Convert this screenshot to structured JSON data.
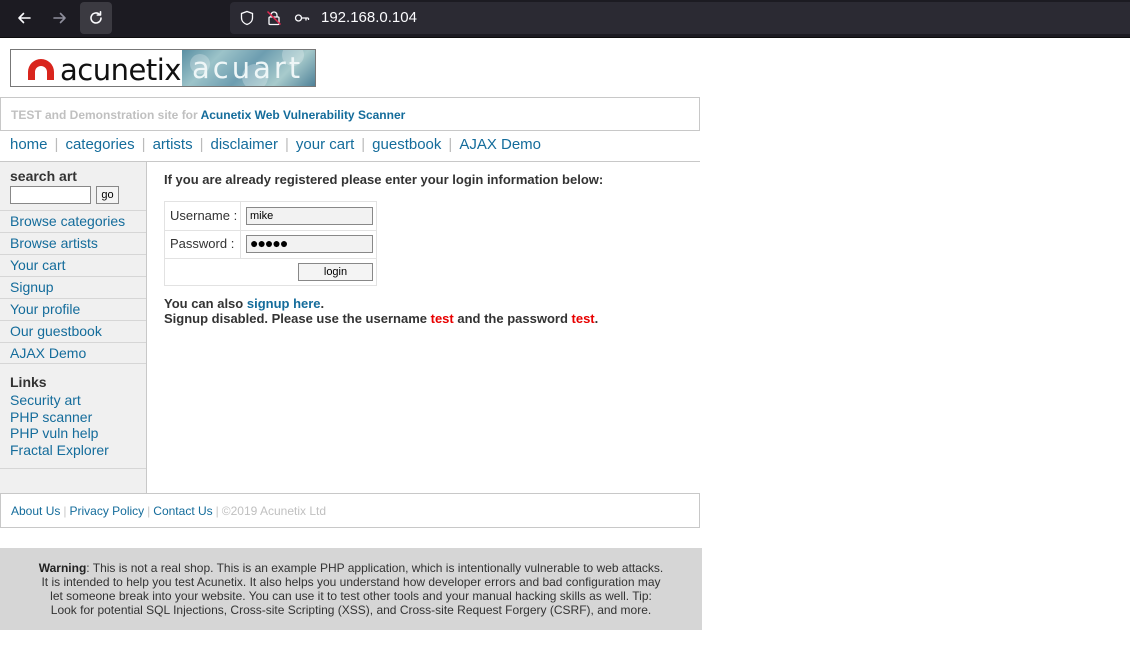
{
  "browser": {
    "url": "192.168.0.104"
  },
  "header": {
    "logo_brand": "acunetix",
    "logo_product": "acuart",
    "tagline_prefix": "TEST and Demonstration site for",
    "tagline_link": "Acunetix Web Vulnerability Scanner"
  },
  "topnav": {
    "items": [
      "home",
      "categories",
      "artists",
      "disclaimer",
      "your cart",
      "guestbook",
      "AJAX Demo"
    ]
  },
  "sidebar": {
    "search_title": "search art",
    "search_value": "",
    "go_label": "go",
    "nav_items": [
      "Browse categories",
      "Browse artists",
      "Your cart",
      "Signup",
      "Your profile",
      "Our guestbook",
      "AJAX Demo"
    ],
    "links_title": "Links",
    "links": [
      "Security art",
      "PHP scanner",
      "PHP vuln help",
      "Fractal Explorer"
    ]
  },
  "login": {
    "intro": "If you are already registered please enter your login information below:",
    "username_label": "Username :",
    "username_value": "mike",
    "password_label": "Password :",
    "password_value": "●●●●●",
    "button_label": "login",
    "signup_prefix": "You can also",
    "signup_link": "signup here",
    "signup_suffix": ".",
    "disabled_1": "Signup disabled. Please use the username",
    "disabled_user": "test",
    "disabled_2": "and the password",
    "disabled_pass": "test",
    "disabled_end": "."
  },
  "footer": {
    "about": "About Us",
    "privacy": "Privacy Policy",
    "contact": "Contact Us",
    "copyright": "©2019 Acunetix Ltd"
  },
  "warning": {
    "title": "Warning",
    "line1": ": This is not a real shop. This is an example PHP application, which is intentionally vulnerable to web attacks.",
    "line2": "It is intended to help you test Acunetix. It also helps you understand how developer errors and bad configuration may",
    "line3": "let someone break into your website. You can use it to test other tools and your manual hacking skills as well. Tip:",
    "line4": "Look for potential SQL Injections, Cross-site Scripting (XSS), and Cross-site Request Forgery (CSRF), and more."
  },
  "colors": {
    "link": "#146c9b",
    "red_highlight": "#e80000",
    "chrome_bg": "#1c1b22",
    "urlbar_bg": "#2b2a33"
  }
}
